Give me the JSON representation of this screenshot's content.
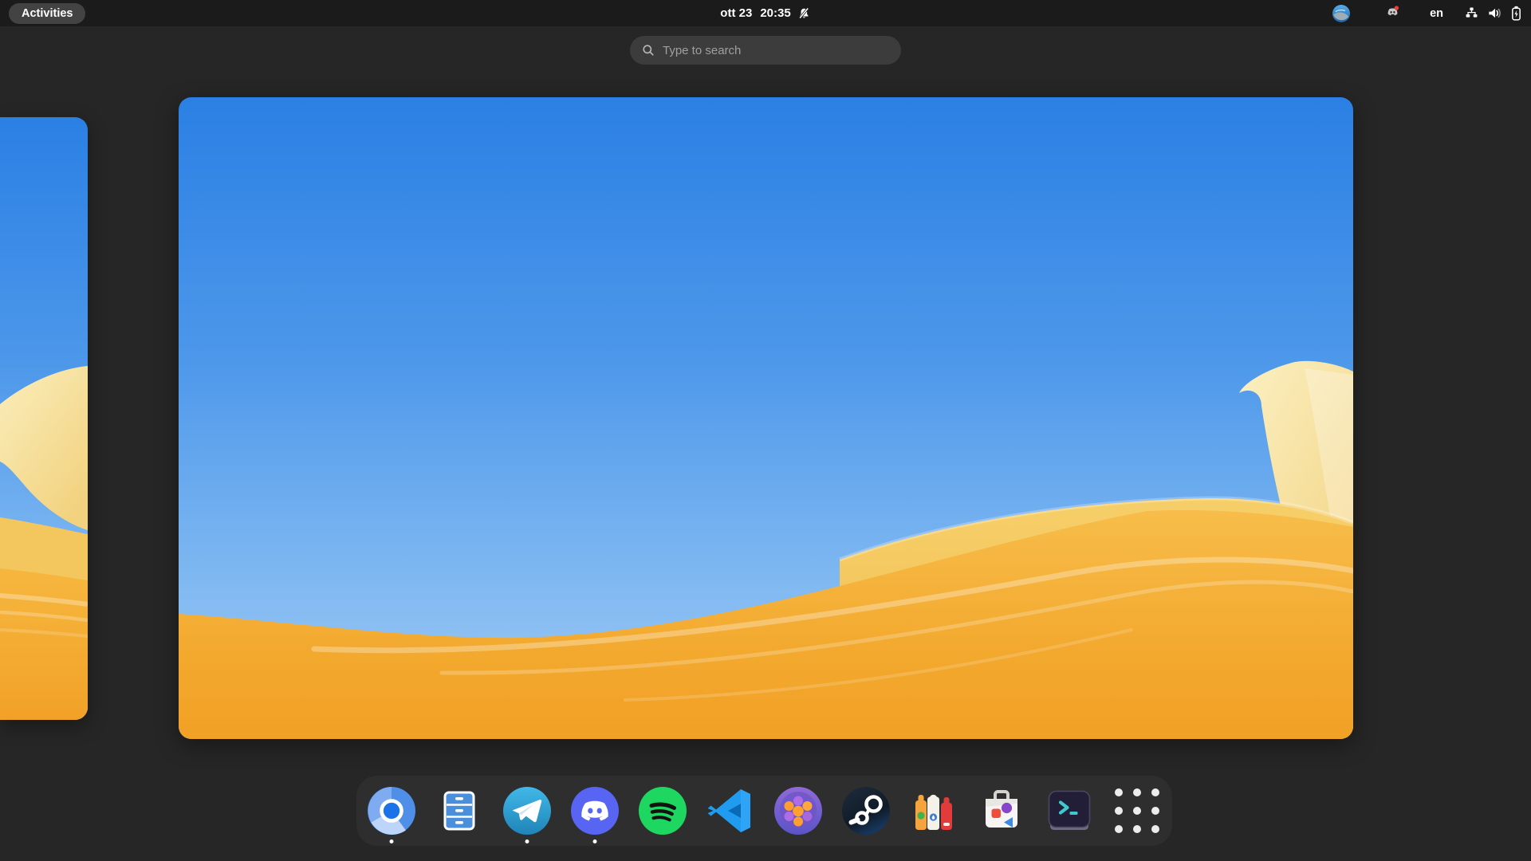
{
  "topbar": {
    "activities_label": "Activities",
    "clock": {
      "date": "ott 23",
      "time": "20:35"
    },
    "notification_icon": "bell-muted-icon",
    "keyboard_layout": "en",
    "tray": {
      "app1_icon": "blue-app-tray-icon",
      "discord_icon": "discord-tray-icon",
      "discord_badge": true,
      "network_icon": "wired-network-icon",
      "volume_icon": "volume-icon",
      "battery_icon": "battery-charging-icon"
    }
  },
  "search": {
    "placeholder": "Type to search",
    "icon": "search-icon"
  },
  "workspaces": {
    "visible": 2,
    "active_index": 1,
    "wallpaper": "blue sky with orange sand dunes"
  },
  "dock": {
    "items": [
      {
        "icon": "chromium-icon",
        "running": true
      },
      {
        "icon": "files-icon",
        "running": false
      },
      {
        "icon": "telegram-icon",
        "running": true
      },
      {
        "icon": "discord-icon",
        "running": true
      },
      {
        "icon": "spotify-icon",
        "running": false
      },
      {
        "icon": "vscode-icon",
        "running": false
      },
      {
        "icon": "molecule-app-icon",
        "running": false
      },
      {
        "icon": "steam-icon",
        "running": false
      },
      {
        "icon": "bottles-icon",
        "running": false
      },
      {
        "icon": "software-store-icon",
        "running": false
      },
      {
        "icon": "console-icon",
        "running": false
      }
    ],
    "app_grid_icon": "app-grid-icon"
  },
  "colors": {
    "topbar_bg": "#1b1b1b",
    "overview_bg": "#262626",
    "dock_bg": "#2e2e2e",
    "pill_bg": "#434343",
    "search_bg": "#3c3c3c",
    "sky_top": "#2b80e4",
    "sky_bottom": "#a3ccf5",
    "dune_front": "#f3a92f",
    "dune_mid": "#f4c65e",
    "dune_crest": "#f8e9ae"
  }
}
